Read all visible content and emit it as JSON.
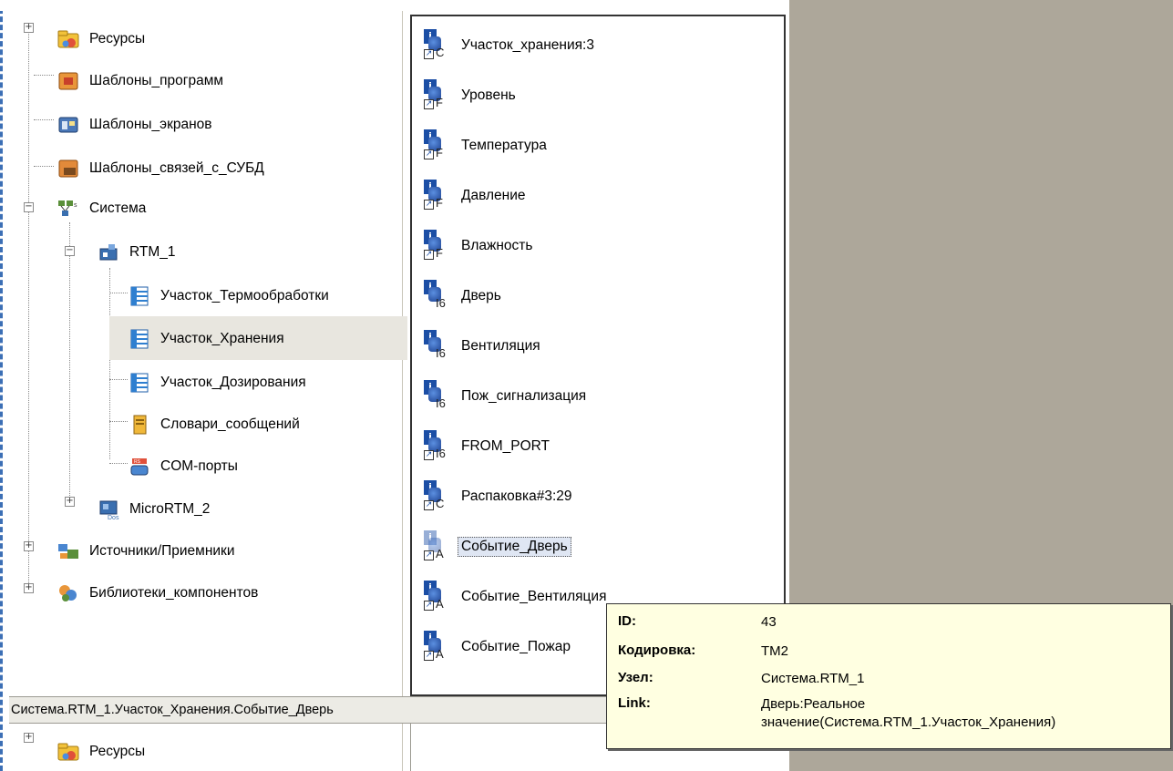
{
  "tree": {
    "items": [
      {
        "label": "Ресурсы",
        "icon": "folder-resources-icon",
        "expander": "+"
      },
      {
        "label": "Шаблоны_программ",
        "icon": "program-templates-icon"
      },
      {
        "label": "Шаблоны_экранов",
        "icon": "screen-templates-icon"
      },
      {
        "label": "Шаблоны_связей_с_СУБД",
        "icon": "dbms-link-templates-icon"
      },
      {
        "label": "Система",
        "icon": "system-network-icon",
        "expander": "−"
      },
      {
        "label": "RTM_1",
        "icon": "rtm-node-icon",
        "expander": "−"
      },
      {
        "label": "Участок_Термообработки",
        "icon": "section-icon"
      },
      {
        "label": "Участок_Хранения",
        "icon": "section-icon",
        "selected": true
      },
      {
        "label": "Участок_Дозирования",
        "icon": "section-icon"
      },
      {
        "label": "Словари_сообщений",
        "icon": "message-dictionary-icon"
      },
      {
        "label": "COM-порты",
        "icon": "com-ports-icon"
      },
      {
        "label": "MicroRTM_2",
        "icon": "micro-rtm-icon",
        "expander": "+"
      },
      {
        "label": "Источники/Приемники",
        "icon": "sources-receivers-icon",
        "expander": "+"
      },
      {
        "label": "Библиотеки_компонентов",
        "icon": "component-libraries-icon",
        "expander": "+"
      }
    ]
  },
  "list": {
    "items": [
      {
        "label": "Участок_хранения:3",
        "type": "C",
        "link": true
      },
      {
        "label": "Уровень",
        "type": "F",
        "link": true
      },
      {
        "label": "Температура",
        "type": "F",
        "link": true
      },
      {
        "label": "Давление",
        "type": "F",
        "link": true
      },
      {
        "label": "Влажность",
        "type": "F",
        "link": true
      },
      {
        "label": "Дверь",
        "type": "I6",
        "link": false
      },
      {
        "label": "Вентиляция",
        "type": "I6",
        "link": false
      },
      {
        "label": "Пож_сигнализация",
        "type": "I6",
        "link": false
      },
      {
        "label": "FROM_PORT",
        "type": "I6",
        "link": true
      },
      {
        "label": "Распаковка#3:29",
        "type": "C",
        "link": true
      },
      {
        "label": "Событие_Дверь",
        "type": "A",
        "link": true,
        "highlighted": true
      },
      {
        "label": "Событие_Вентиляция",
        "type": "A",
        "link": true
      },
      {
        "label": "Событие_Пожар",
        "type": "A",
        "link": true
      }
    ]
  },
  "status_bar": {
    "path": "Система.RTM_1.Участок_Хранения.Событие_Дверь"
  },
  "bottom_tree": {
    "first_item": "Ресурсы"
  },
  "tooltip": {
    "rows": [
      {
        "key": "ID:",
        "value": "43"
      },
      {
        "key": "Кодировка:",
        "value": "TM2"
      },
      {
        "key": "Узел:",
        "value": "Система.RTM_1"
      },
      {
        "key": "Link:",
        "value": "Дверь:Реальное",
        "value2": "значение(Система.RTM_1.Участок_Хранения)"
      }
    ]
  },
  "colors": {
    "grey_background": "#ada79a",
    "tooltip_background": "#ffffe1",
    "tag_icon_blue": "#1b4ea5",
    "selection_background": "#e8e6df"
  }
}
